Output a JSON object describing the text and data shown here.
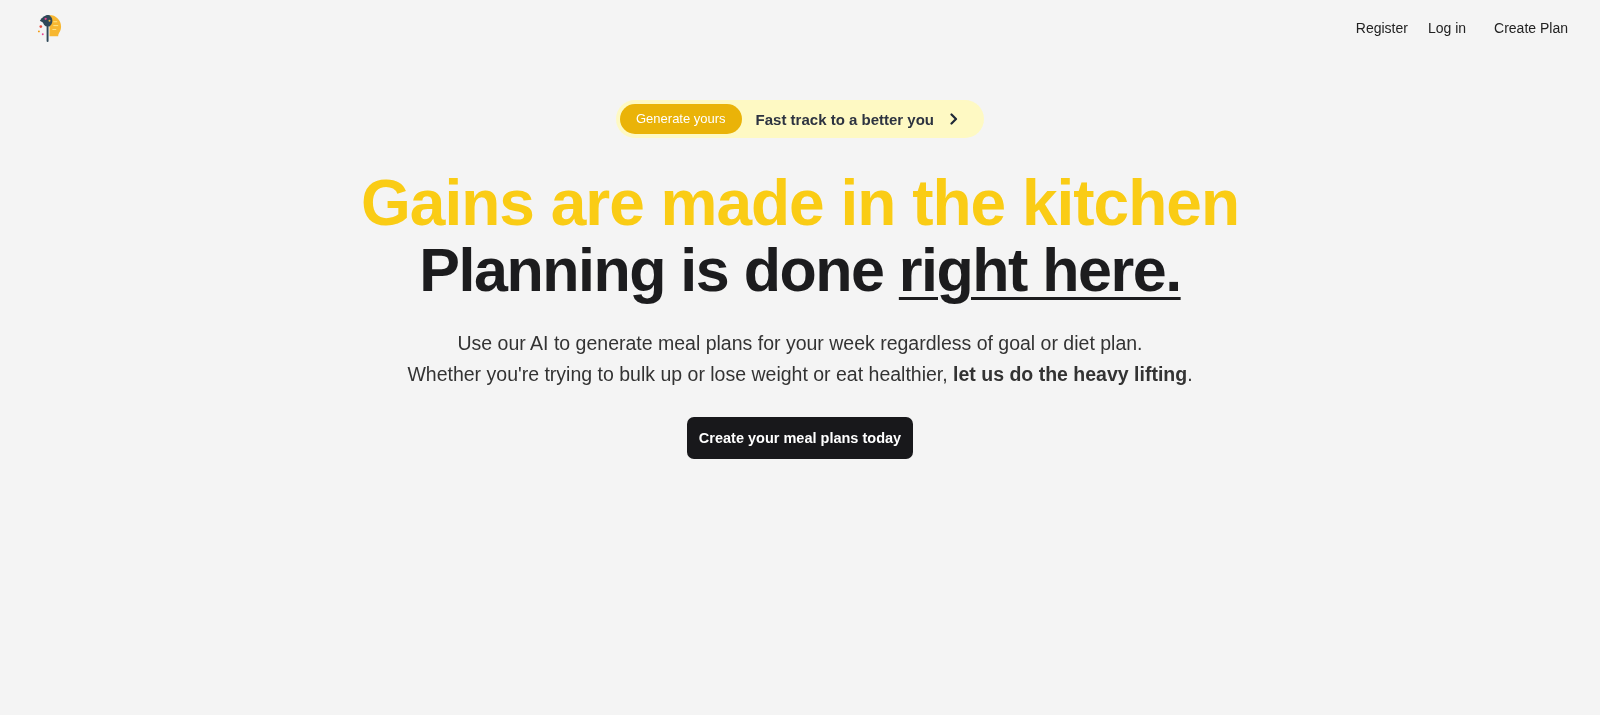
{
  "header": {
    "nav": [
      {
        "label": "Register"
      },
      {
        "label": "Log in"
      },
      {
        "label": "Create Plan"
      }
    ]
  },
  "announcement": {
    "badge": "Generate yours",
    "text": "Fast track to a better you"
  },
  "hero": {
    "headline": "Gains are made in the kitchen",
    "subheadline": {
      "text": "Planning is done",
      "link": "right here."
    },
    "description": [
      "Use our AI to generate meal plans for your week regardless of goal or diet plan.",
      "Whether you're trying to bulk up or lose weight or eat healthier, **let us do the heavy lifting**."
    ],
    "cta": "Create your meal plans today"
  }
}
